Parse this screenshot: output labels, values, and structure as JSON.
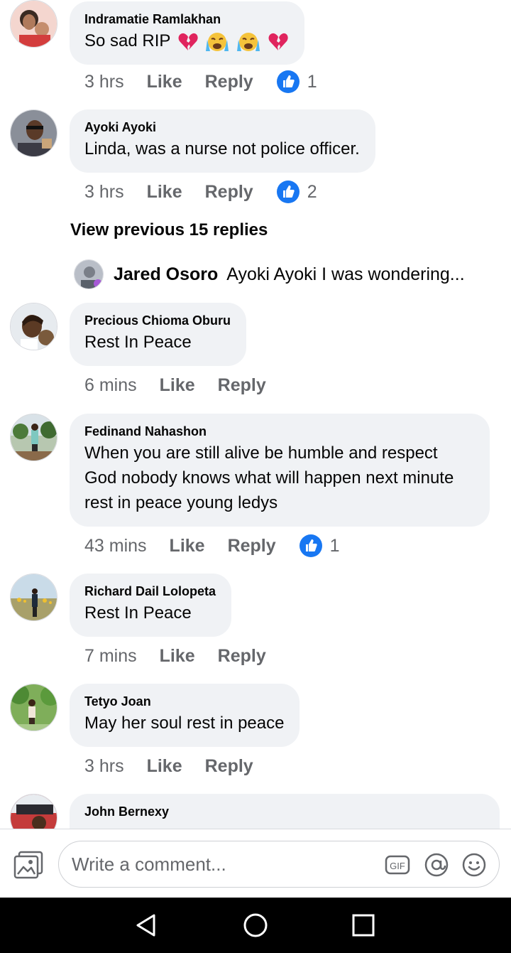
{
  "comments": [
    {
      "author": "Indramatie Ramlakhan",
      "text": "So sad RIP",
      "emojis": [
        "broken-heart",
        "crying-face",
        "crying-face",
        "broken-heart"
      ],
      "time": "3 hrs",
      "like": "Like",
      "reply": "Reply",
      "reactions": "1"
    },
    {
      "author": "Ayoki Ayoki",
      "text": "Linda, was a nurse not police officer.",
      "time": "3 hrs",
      "like": "Like",
      "reply": "Reply",
      "reactions": "2"
    },
    {
      "author": "Precious Chioma Oburu",
      "text": "Rest In Peace",
      "time": "6 mins",
      "like": "Like",
      "reply": "Reply"
    },
    {
      "author": "Fedinand Nahashon",
      "text": "When you are still alive be humble and respect God nobody knows what will happen next minute rest in peace young ledys",
      "time": "43 mins",
      "like": "Like",
      "reply": "Reply",
      "reactions": "1"
    },
    {
      "author": "Richard Dail Lolopeta",
      "text": "Rest In Peace",
      "time": "7 mins",
      "like": "Like",
      "reply": "Reply"
    },
    {
      "author": "Tetyo Joan",
      "text": "May her soul rest in peace",
      "time": "3 hrs",
      "like": "Like",
      "reply": "Reply"
    },
    {
      "author": "John Bernexy"
    }
  ],
  "replies": {
    "view_previous": "View previous 15 replies",
    "preview_author": "Jared Osoro",
    "preview_text": "Ayoki Ayoki I was wondering..."
  },
  "composer": {
    "placeholder": "Write a comment...",
    "icons": [
      "photo-icon",
      "gif-icon",
      "mention-icon",
      "emoji-icon"
    ]
  },
  "colors": {
    "bubble": "#f0f2f5",
    "like_blue": "#1877f2",
    "secondary_text": "#65676b",
    "nav_bar": "#000000"
  }
}
